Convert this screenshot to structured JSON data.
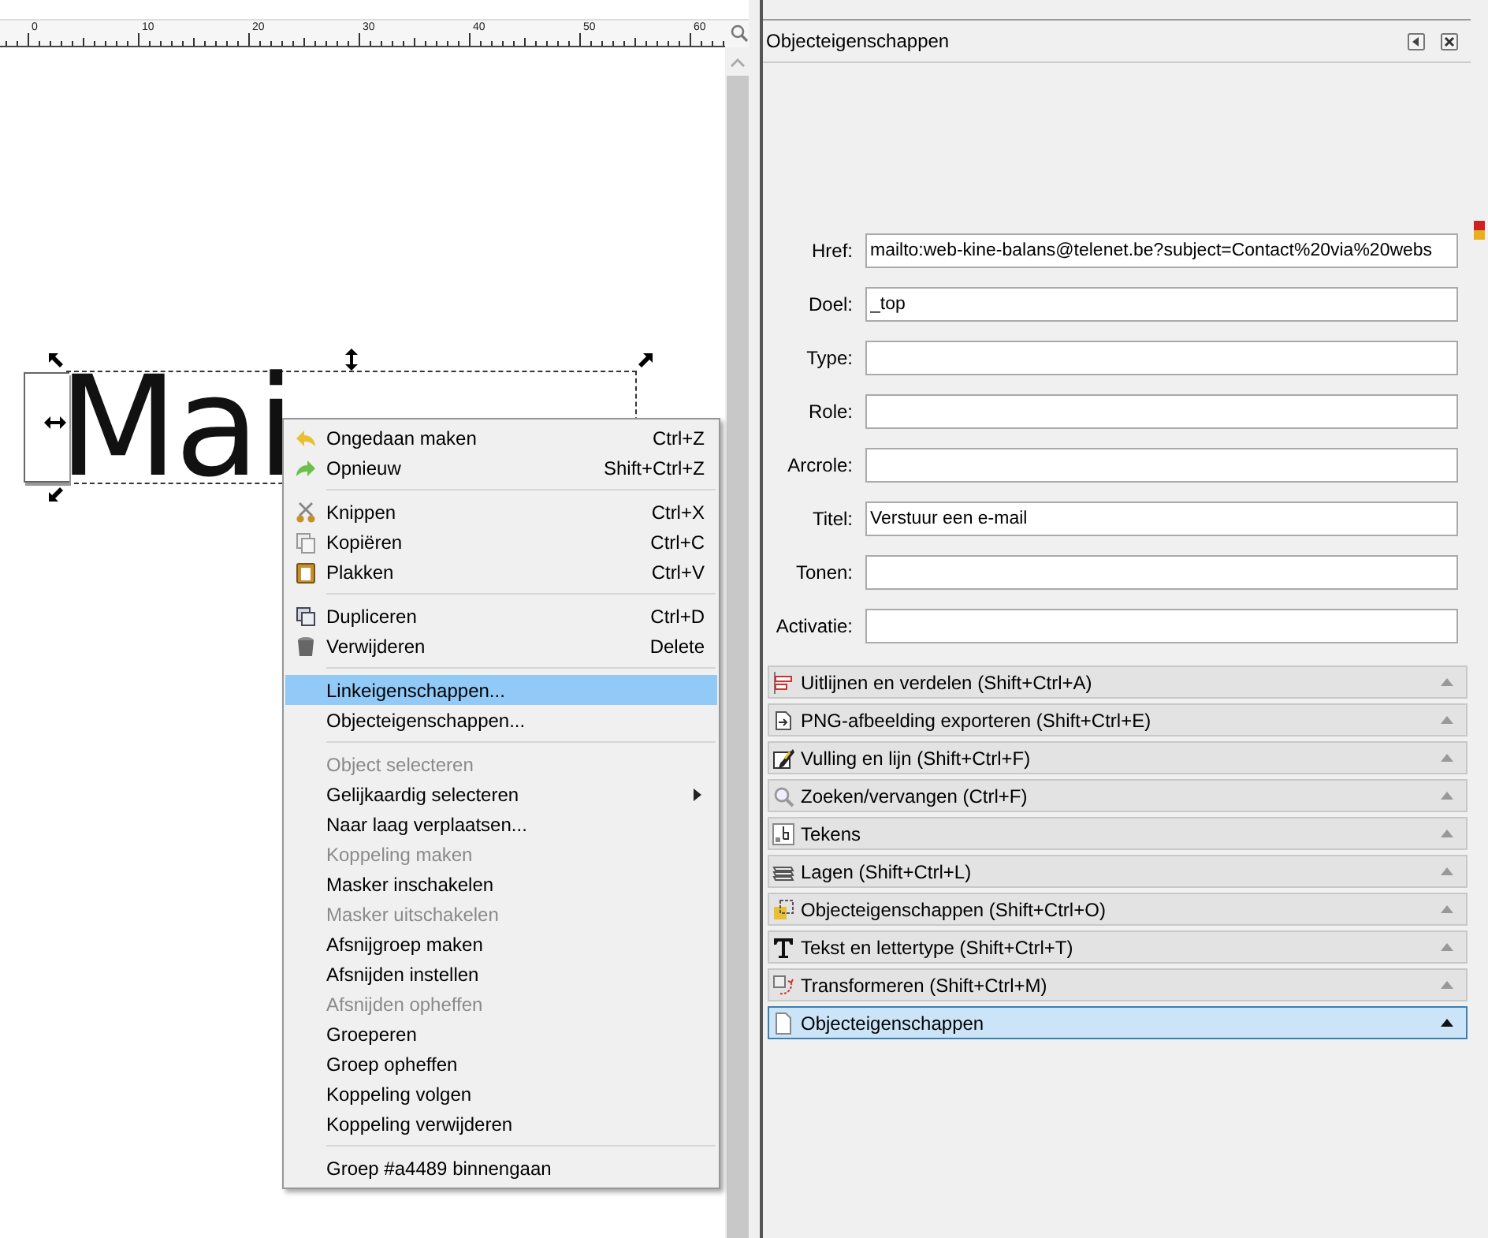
{
  "ruler": {
    "labels": [
      "0",
      "10",
      "20",
      "30",
      "40",
      "50",
      "60"
    ]
  },
  "canvas": {
    "text": "Mai"
  },
  "context_menu": [
    {
      "kind": "item",
      "label": "Ongedaan maken",
      "shortcut": "Ctrl+Z",
      "disabled": false,
      "selected": false
    },
    {
      "kind": "item",
      "label": "Opnieuw",
      "shortcut": "Shift+Ctrl+Z",
      "disabled": false,
      "selected": false
    },
    {
      "kind": "separator"
    },
    {
      "kind": "item",
      "label": "Knippen",
      "shortcut": "Ctrl+X",
      "disabled": false,
      "selected": false
    },
    {
      "kind": "item",
      "label": "Kopiëren",
      "shortcut": "Ctrl+C",
      "disabled": false,
      "selected": false
    },
    {
      "kind": "item",
      "label": "Plakken",
      "shortcut": "Ctrl+V",
      "disabled": false,
      "selected": false
    },
    {
      "kind": "separator"
    },
    {
      "kind": "item",
      "label": "Dupliceren",
      "shortcut": "Ctrl+D",
      "disabled": false,
      "selected": false
    },
    {
      "kind": "item",
      "label": "Verwijderen",
      "shortcut": "Delete",
      "disabled": false,
      "selected": false
    },
    {
      "kind": "separator"
    },
    {
      "kind": "item",
      "label": "Linkeigenschappen...",
      "disabled": false,
      "selected": true
    },
    {
      "kind": "item",
      "label": "Objecteigenschappen...",
      "disabled": false,
      "selected": false
    },
    {
      "kind": "separator"
    },
    {
      "kind": "item",
      "label": "Object selecteren",
      "disabled": true,
      "selected": false
    },
    {
      "kind": "submenu",
      "label": "Gelijkaardig selecteren",
      "disabled": false,
      "selected": false
    },
    {
      "kind": "item",
      "label": "Naar laag verplaatsen...",
      "disabled": false,
      "selected": false
    },
    {
      "kind": "item",
      "label": "Koppeling maken",
      "disabled": true,
      "selected": false
    },
    {
      "kind": "item",
      "label": "Masker inschakelen",
      "disabled": false,
      "selected": false
    },
    {
      "kind": "item",
      "label": "Masker uitschakelen",
      "disabled": true,
      "selected": false
    },
    {
      "kind": "item",
      "label": "Afsnijgroep maken",
      "disabled": false,
      "selected": false
    },
    {
      "kind": "item",
      "label": "Afsnijden instellen",
      "disabled": false,
      "selected": false
    },
    {
      "kind": "item",
      "label": "Afsnijden opheffen",
      "disabled": true,
      "selected": false
    },
    {
      "kind": "item",
      "label": "Groeperen",
      "disabled": false,
      "selected": false
    },
    {
      "kind": "item",
      "label": "Groep opheffen",
      "disabled": false,
      "selected": false
    },
    {
      "kind": "item",
      "label": "Koppeling volgen",
      "disabled": false,
      "selected": false
    },
    {
      "kind": "item",
      "label": "Koppeling verwijderen",
      "disabled": false,
      "selected": false
    },
    {
      "kind": "separator"
    },
    {
      "kind": "item",
      "label": "Groep #a4489 binnengaan",
      "disabled": false,
      "selected": false
    }
  ],
  "panel": {
    "title": "Objecteigenschappen",
    "fields": [
      {
        "label": "Href:",
        "value": "mailto:web-kine-balans@telenet.be?subject=Contact%20via%20webs"
      },
      {
        "label": "Doel:",
        "value": "_top"
      },
      {
        "label": "Type:"
      },
      {
        "label": "Role:"
      },
      {
        "label": "Arcrole:"
      },
      {
        "label": "Titel:",
        "value": "Verstuur een e-mail"
      },
      {
        "label": "Tonen:"
      },
      {
        "label": "Activatie:"
      }
    ]
  },
  "docks": [
    {
      "label": "Uitlijnen en verdelen (Shift+Ctrl+A)",
      "selected": false
    },
    {
      "label": "PNG-afbeelding exporteren (Shift+Ctrl+E)",
      "selected": false
    },
    {
      "label": "Vulling en lijn (Shift+Ctrl+F)",
      "selected": false
    },
    {
      "label": "Zoeken/vervangen (Ctrl+F)",
      "selected": false
    },
    {
      "label": "Tekens",
      "selected": false
    },
    {
      "label": "Lagen (Shift+Ctrl+L)",
      "selected": false
    },
    {
      "label": "Objecteigenschappen (Shift+Ctrl+O)",
      "selected": false
    },
    {
      "label": "Tekst en lettertype (Shift+Ctrl+T)",
      "selected": false
    },
    {
      "label": "Transformeren (Shift+Ctrl+M)",
      "selected": false
    },
    {
      "label": "Objecteigenschappen",
      "selected": true
    }
  ]
}
